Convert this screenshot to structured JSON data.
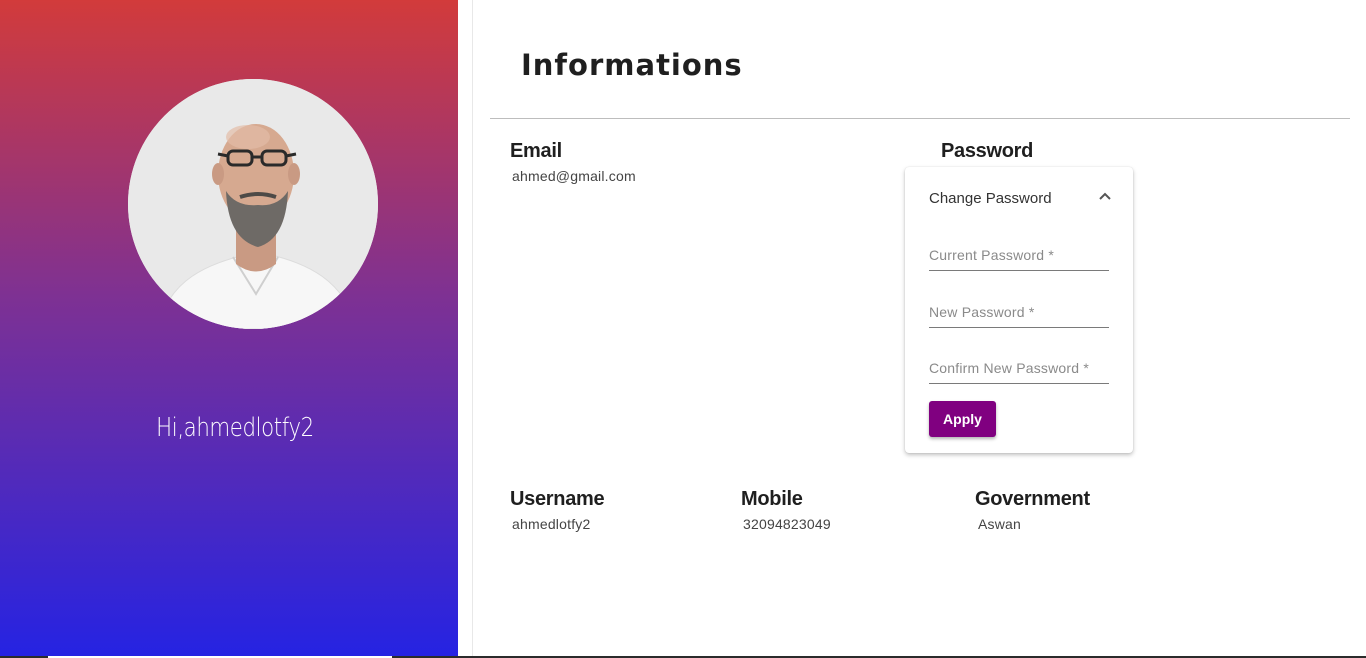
{
  "profile": {
    "greeting": "Hi,ahmedlotfy2",
    "avatar_alt": "profile photo"
  },
  "info": {
    "title": "Informations",
    "email": {
      "label": "Email",
      "value": "ahmed@gmail.com"
    },
    "password": {
      "label": "Password"
    },
    "username": {
      "label": "Username",
      "value": "ahmedlotfy2"
    },
    "mobile": {
      "label": "Mobile",
      "value": "32094823049"
    },
    "government": {
      "label": "Government",
      "value": "Aswan"
    }
  },
  "change_password": {
    "header": "Change Password",
    "expanded": true,
    "current_placeholder": "Current Password *",
    "new_placeholder": "New Password *",
    "confirm_placeholder": "Confirm New Password *",
    "apply_label": "Apply",
    "apply_color": "#800080"
  },
  "colors": {
    "panel_gradient_top": "#d23b3b",
    "panel_gradient_mid": "#7e3193",
    "panel_gradient_bottom": "#2523e3"
  }
}
